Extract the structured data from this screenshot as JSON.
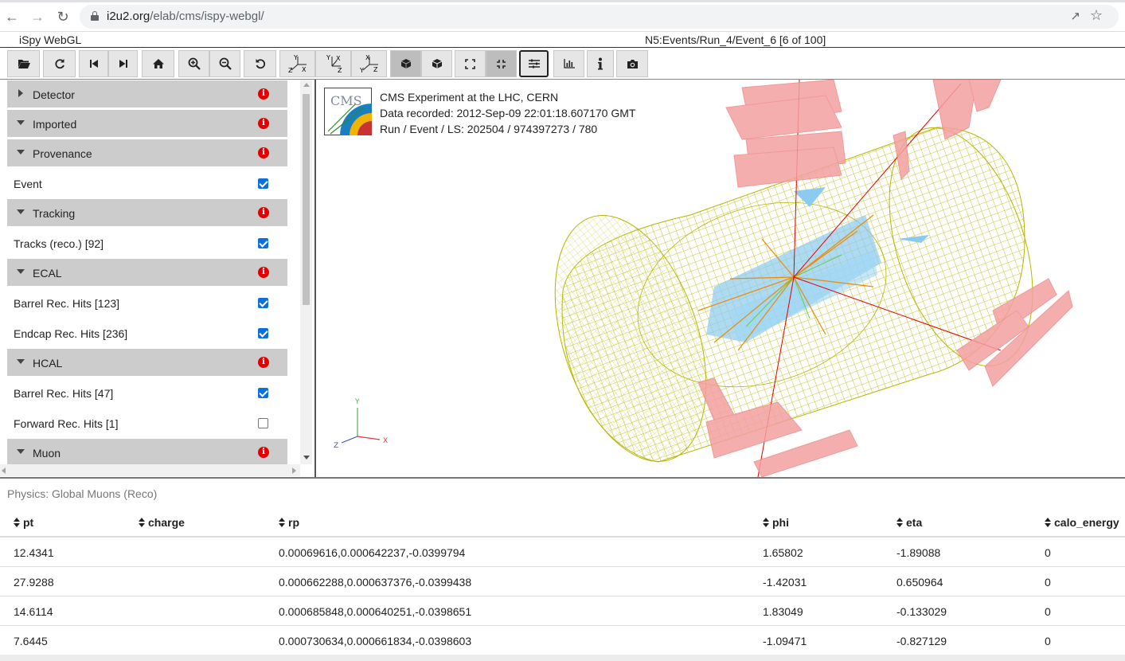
{
  "browser": {
    "url_host": "i2u2.org",
    "url_path": "/elab/cms/ispy-webgl/"
  },
  "app": {
    "title": "iSpy WebGL",
    "event_title": "N5:Events/Run_4/Event_6 [6 of 100]"
  },
  "toolbar": {
    "buttons": [
      {
        "name": "open-file-button",
        "icon": "folder-open-icon"
      },
      {
        "name": "reload-button",
        "icon": "reload-icon"
      },
      {
        "name": "previous-event-button",
        "icon": "step-backward-icon"
      },
      {
        "name": "next-event-button",
        "icon": "step-forward-icon"
      },
      {
        "name": "home-view-button",
        "icon": "home-icon"
      },
      {
        "name": "zoom-in-button",
        "icon": "zoom-in-icon"
      },
      {
        "name": "zoom-out-button",
        "icon": "zoom-out-icon"
      },
      {
        "name": "reset-view-button",
        "icon": "undo-icon"
      },
      {
        "name": "view-yx-button",
        "icon": "axis-yx-icon"
      },
      {
        "name": "view-yz-button",
        "icon": "axis-yz-icon"
      },
      {
        "name": "view-xz-button",
        "icon": "axis-xz-icon"
      },
      {
        "name": "perspective-button",
        "icon": "cube-solid-icon"
      },
      {
        "name": "orthographic-button",
        "icon": "cube-icon"
      },
      {
        "name": "fullscreen-button",
        "icon": "expand-icon"
      },
      {
        "name": "exit-fullscreen-button",
        "icon": "compress-icon"
      },
      {
        "name": "settings-button",
        "icon": "sliders-icon"
      },
      {
        "name": "table-view-button",
        "icon": "bar-chart-icon"
      },
      {
        "name": "info-button",
        "icon": "info-icon"
      },
      {
        "name": "screenshot-button",
        "icon": "camera-icon"
      }
    ],
    "axis_labels": {
      "yx": {
        "top": "Y",
        "left": "Z",
        "right": "X"
      },
      "yz": {
        "top": "Y",
        "left": "X",
        "right": "Z"
      },
      "xz": {
        "top": "X",
        "left": "Y",
        "right": "Z"
      }
    }
  },
  "sidebar": {
    "sections": [
      {
        "label": "Detector",
        "expanded": false,
        "items": []
      },
      {
        "label": "Imported",
        "expanded": true,
        "items": []
      },
      {
        "label": "Provenance",
        "expanded": true,
        "items": [
          {
            "label": "Event",
            "checked": true
          }
        ]
      },
      {
        "label": "Tracking",
        "expanded": true,
        "items": [
          {
            "label": "Tracks (reco.) [92]",
            "checked": true
          }
        ]
      },
      {
        "label": "ECAL",
        "expanded": true,
        "items": [
          {
            "label": "Barrel Rec. Hits [123]",
            "checked": true
          },
          {
            "label": "Endcap Rec. Hits [236]",
            "checked": true
          }
        ]
      },
      {
        "label": "HCAL",
        "expanded": true,
        "items": [
          {
            "label": "Barrel Rec. Hits [47]",
            "checked": true
          },
          {
            "label": "Forward Rec. Hits [1]",
            "checked": false
          }
        ]
      },
      {
        "label": "Muon",
        "expanded": true,
        "items": []
      }
    ],
    "info_glyph": "i"
  },
  "viewport": {
    "logo_text": "CMS",
    "experiment": "CMS Experiment at the LHC, CERN",
    "recorded": "Data recorded: 2012-Sep-09 22:01:18.607170 GMT",
    "run_event": "Run / Event / LS: 202504 / 974397273 / 780",
    "axes": {
      "x": "X",
      "y": "Y",
      "z": "Z"
    },
    "colors": {
      "muon_chambers": "#f4a0a0",
      "hcal_wireframe": "#b5b500",
      "ecal_hits": "#8ccbf0",
      "tracks": "#f08a00",
      "muon_track": "#e00000"
    }
  },
  "table": {
    "caption": "Physics: Global Muons (Reco)",
    "columns": [
      "pt",
      "charge",
      "rp",
      "phi",
      "eta",
      "calo_energy"
    ],
    "rows": [
      [
        "12.4341",
        "",
        "0.00069616,0.000642237,-0.0399794",
        "1.65802",
        "-1.89088",
        "0"
      ],
      [
        "27.9288",
        "",
        "0.000662288,0.000637376,-0.0399438",
        "-1.42031",
        "0.650964",
        "0"
      ],
      [
        "14.6114",
        "",
        "0.000685848,0.000640251,-0.0398651",
        "1.83049",
        "-0.133029",
        "0"
      ],
      [
        "7.6445",
        "",
        "0.000730634,0.000661834,-0.0398603",
        "-1.09471",
        "-0.827129",
        "0"
      ]
    ]
  }
}
